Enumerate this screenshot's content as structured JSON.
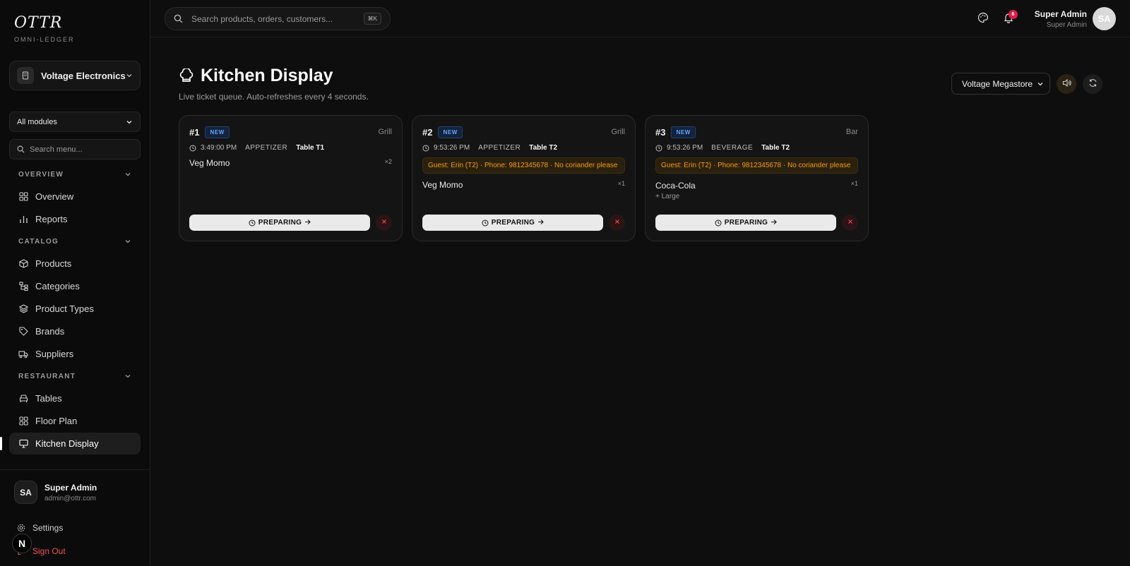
{
  "brand": {
    "logo": "OTTR",
    "subtitle": "OMNI-LEDGER"
  },
  "org": {
    "name": "Voltage Electronics"
  },
  "modules": {
    "selected": "All modules"
  },
  "menu_search": {
    "placeholder": "Search menu..."
  },
  "sidebar": {
    "sections": [
      {
        "label": "OVERVIEW",
        "items": [
          {
            "label": "Overview",
            "icon": "grid-icon"
          },
          {
            "label": "Reports",
            "icon": "bar-chart-icon"
          }
        ]
      },
      {
        "label": "CATALOG",
        "items": [
          {
            "label": "Products",
            "icon": "box-icon"
          },
          {
            "label": "Categories",
            "icon": "tree-icon"
          },
          {
            "label": "Product Types",
            "icon": "layers-icon"
          },
          {
            "label": "Brands",
            "icon": "tag-icon"
          },
          {
            "label": "Suppliers",
            "icon": "truck-icon"
          }
        ]
      },
      {
        "label": "RESTAURANT",
        "items": [
          {
            "label": "Tables",
            "icon": "armchair-icon"
          },
          {
            "label": "Floor Plan",
            "icon": "grid-icon"
          },
          {
            "label": "Kitchen Display",
            "icon": "monitor-icon",
            "active": true
          }
        ]
      }
    ]
  },
  "sidebar_user": {
    "name": "Super Admin",
    "email": "admin@ottr.com",
    "initials": "SA"
  },
  "footer_links": {
    "settings": "Settings",
    "sign_out": "Sign Out"
  },
  "dev_badge": "N",
  "topbar": {
    "search_placeholder": "Search products, orders, customers...",
    "shortcut": "⌘K",
    "notification_count": "6",
    "user_name": "Super Admin",
    "user_role": "Super Admin",
    "user_initials": "SA"
  },
  "page": {
    "title": "Kitchen Display",
    "subtitle": "Live ticket queue. Auto-refreshes every 4 seconds.",
    "store_select": "Voltage Megastore"
  },
  "tickets": [
    {
      "number": "#1",
      "status": "NEW",
      "station": "Grill",
      "time": "3:49:00 PM",
      "category": "APPETIZER",
      "table": "Table T1",
      "note": "",
      "item": "Veg Momo",
      "qty": "×2",
      "modifier": "",
      "action": "PREPARING"
    },
    {
      "number": "#2",
      "status": "NEW",
      "station": "Grill",
      "time": "9:53:26 PM",
      "category": "APPETIZER",
      "table": "Table T2",
      "note": "Guest: Erin (T2) · Phone: 9812345678 · No coriander please",
      "item": "Veg Momo",
      "qty": "×1",
      "modifier": "",
      "action": "PREPARING"
    },
    {
      "number": "#3",
      "status": "NEW",
      "station": "Bar",
      "time": "9:53:26 PM",
      "category": "BEVERAGE",
      "table": "Table T2",
      "note": "Guest: Erin (T2) · Phone: 9812345678 · No coriander please",
      "item": "Coca-Cola",
      "qty": "×1",
      "modifier": "+ Large",
      "action": "PREPARING"
    }
  ],
  "colors": {
    "background": "#0e0e0e",
    "accent_badge": "#60a5fa",
    "note_text": "#f59e0b",
    "danger": "#ef4444"
  }
}
